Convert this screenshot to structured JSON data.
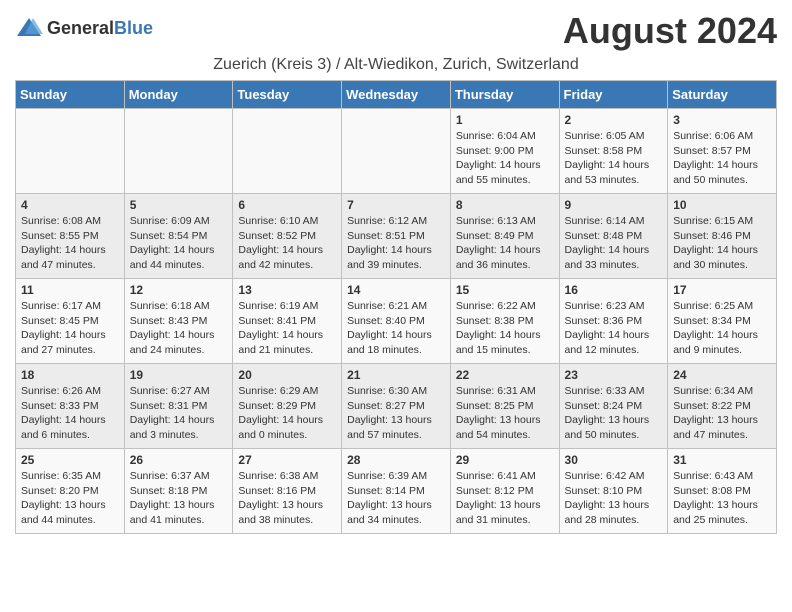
{
  "logo": {
    "general": "General",
    "blue": "Blue"
  },
  "title": "August 2024",
  "subtitle": "Zuerich (Kreis 3) / Alt-Wiedikon, Zurich, Switzerland",
  "days_of_week": [
    "Sunday",
    "Monday",
    "Tuesday",
    "Wednesday",
    "Thursday",
    "Friday",
    "Saturday"
  ],
  "weeks": [
    [
      {
        "day": "",
        "info": ""
      },
      {
        "day": "",
        "info": ""
      },
      {
        "day": "",
        "info": ""
      },
      {
        "day": "",
        "info": ""
      },
      {
        "day": "1",
        "info": "Sunrise: 6:04 AM\nSunset: 9:00 PM\nDaylight: 14 hours and 55 minutes."
      },
      {
        "day": "2",
        "info": "Sunrise: 6:05 AM\nSunset: 8:58 PM\nDaylight: 14 hours and 53 minutes."
      },
      {
        "day": "3",
        "info": "Sunrise: 6:06 AM\nSunset: 8:57 PM\nDaylight: 14 hours and 50 minutes."
      }
    ],
    [
      {
        "day": "4",
        "info": "Sunrise: 6:08 AM\nSunset: 8:55 PM\nDaylight: 14 hours and 47 minutes."
      },
      {
        "day": "5",
        "info": "Sunrise: 6:09 AM\nSunset: 8:54 PM\nDaylight: 14 hours and 44 minutes."
      },
      {
        "day": "6",
        "info": "Sunrise: 6:10 AM\nSunset: 8:52 PM\nDaylight: 14 hours and 42 minutes."
      },
      {
        "day": "7",
        "info": "Sunrise: 6:12 AM\nSunset: 8:51 PM\nDaylight: 14 hours and 39 minutes."
      },
      {
        "day": "8",
        "info": "Sunrise: 6:13 AM\nSunset: 8:49 PM\nDaylight: 14 hours and 36 minutes."
      },
      {
        "day": "9",
        "info": "Sunrise: 6:14 AM\nSunset: 8:48 PM\nDaylight: 14 hours and 33 minutes."
      },
      {
        "day": "10",
        "info": "Sunrise: 6:15 AM\nSunset: 8:46 PM\nDaylight: 14 hours and 30 minutes."
      }
    ],
    [
      {
        "day": "11",
        "info": "Sunrise: 6:17 AM\nSunset: 8:45 PM\nDaylight: 14 hours and 27 minutes."
      },
      {
        "day": "12",
        "info": "Sunrise: 6:18 AM\nSunset: 8:43 PM\nDaylight: 14 hours and 24 minutes."
      },
      {
        "day": "13",
        "info": "Sunrise: 6:19 AM\nSunset: 8:41 PM\nDaylight: 14 hours and 21 minutes."
      },
      {
        "day": "14",
        "info": "Sunrise: 6:21 AM\nSunset: 8:40 PM\nDaylight: 14 hours and 18 minutes."
      },
      {
        "day": "15",
        "info": "Sunrise: 6:22 AM\nSunset: 8:38 PM\nDaylight: 14 hours and 15 minutes."
      },
      {
        "day": "16",
        "info": "Sunrise: 6:23 AM\nSunset: 8:36 PM\nDaylight: 14 hours and 12 minutes."
      },
      {
        "day": "17",
        "info": "Sunrise: 6:25 AM\nSunset: 8:34 PM\nDaylight: 14 hours and 9 minutes."
      }
    ],
    [
      {
        "day": "18",
        "info": "Sunrise: 6:26 AM\nSunset: 8:33 PM\nDaylight: 14 hours and 6 minutes."
      },
      {
        "day": "19",
        "info": "Sunrise: 6:27 AM\nSunset: 8:31 PM\nDaylight: 14 hours and 3 minutes."
      },
      {
        "day": "20",
        "info": "Sunrise: 6:29 AM\nSunset: 8:29 PM\nDaylight: 14 hours and 0 minutes."
      },
      {
        "day": "21",
        "info": "Sunrise: 6:30 AM\nSunset: 8:27 PM\nDaylight: 13 hours and 57 minutes."
      },
      {
        "day": "22",
        "info": "Sunrise: 6:31 AM\nSunset: 8:25 PM\nDaylight: 13 hours and 54 minutes."
      },
      {
        "day": "23",
        "info": "Sunrise: 6:33 AM\nSunset: 8:24 PM\nDaylight: 13 hours and 50 minutes."
      },
      {
        "day": "24",
        "info": "Sunrise: 6:34 AM\nSunset: 8:22 PM\nDaylight: 13 hours and 47 minutes."
      }
    ],
    [
      {
        "day": "25",
        "info": "Sunrise: 6:35 AM\nSunset: 8:20 PM\nDaylight: 13 hours and 44 minutes."
      },
      {
        "day": "26",
        "info": "Sunrise: 6:37 AM\nSunset: 8:18 PM\nDaylight: 13 hours and 41 minutes."
      },
      {
        "day": "27",
        "info": "Sunrise: 6:38 AM\nSunset: 8:16 PM\nDaylight: 13 hours and 38 minutes."
      },
      {
        "day": "28",
        "info": "Sunrise: 6:39 AM\nSunset: 8:14 PM\nDaylight: 13 hours and 34 minutes."
      },
      {
        "day": "29",
        "info": "Sunrise: 6:41 AM\nSunset: 8:12 PM\nDaylight: 13 hours and 31 minutes."
      },
      {
        "day": "30",
        "info": "Sunrise: 6:42 AM\nSunset: 8:10 PM\nDaylight: 13 hours and 28 minutes."
      },
      {
        "day": "31",
        "info": "Sunrise: 6:43 AM\nSunset: 8:08 PM\nDaylight: 13 hours and 25 minutes."
      }
    ]
  ]
}
